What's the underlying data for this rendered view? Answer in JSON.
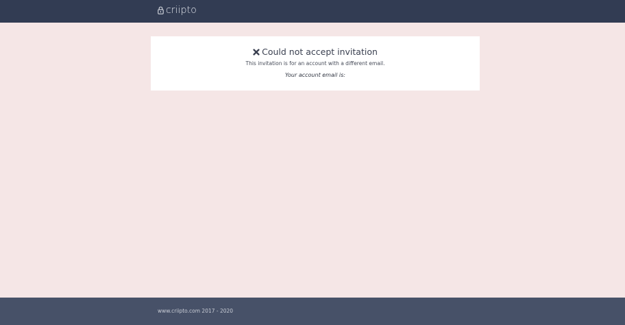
{
  "header": {
    "brand_name": "criipto",
    "logo_icon": "lock-icon",
    "background_color": "#323c53"
  },
  "card": {
    "title_icon": "close-icon",
    "title": "Could not accept invitation",
    "message": "This invitation is for an account with a different email.",
    "email_label": "Your account email is:"
  },
  "footer": {
    "text": "www.criipto.com 2017 - 2020",
    "background_color": "#475168"
  },
  "page": {
    "background_color": "#f5e6e6"
  }
}
